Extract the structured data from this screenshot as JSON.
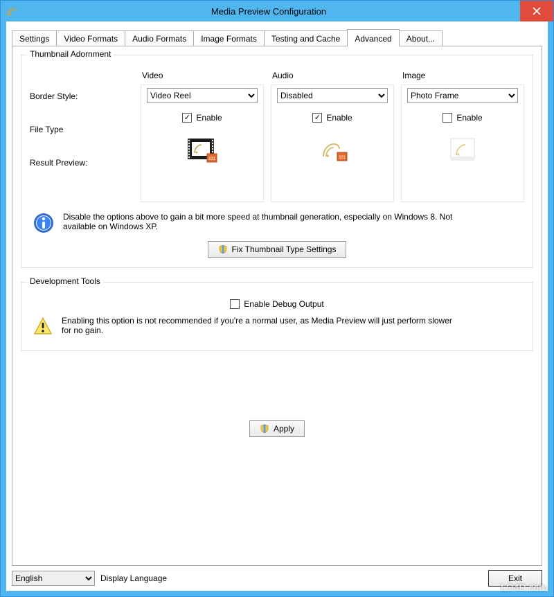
{
  "window": {
    "title": "Media Preview Configuration"
  },
  "tabs": [
    {
      "label": "Settings"
    },
    {
      "label": "Video Formats"
    },
    {
      "label": "Audio Formats"
    },
    {
      "label": "Image Formats"
    },
    {
      "label": "Testing and Cache"
    },
    {
      "label": "Advanced"
    },
    {
      "label": "About..."
    }
  ],
  "adornment": {
    "group_title": "Thumbnail Adornment",
    "columns": {
      "video": "Video",
      "audio": "Audio",
      "image": "Image"
    },
    "rows": {
      "border_style": "Border Style:",
      "file_type": "File Type",
      "result_preview": "Result Preview:"
    },
    "video": {
      "border_style": "Video Reel",
      "enable_label": "Enable",
      "enable_checked": true
    },
    "audio": {
      "border_style": "Disabled",
      "enable_label": "Enable",
      "enable_checked": true
    },
    "image": {
      "border_style": "Photo Frame",
      "enable_label": "Enable",
      "enable_checked": false
    },
    "info_text": "Disable the options above to gain a bit more speed at thumbnail generation, especially on Windows 8. Not available on Windows XP.",
    "fix_button": "Fix Thumbnail Type Settings"
  },
  "dev": {
    "group_title": "Development Tools",
    "debug_label": "Enable Debug Output",
    "debug_checked": false,
    "warn_text": "Enabling this option is not recommended if you're a normal user, as Media Preview will just perform slower for no gain."
  },
  "apply_button": "Apply",
  "language": {
    "value": "English",
    "label": "Display Language"
  },
  "exit_button": "Exit",
  "watermark": "LO4D.com"
}
